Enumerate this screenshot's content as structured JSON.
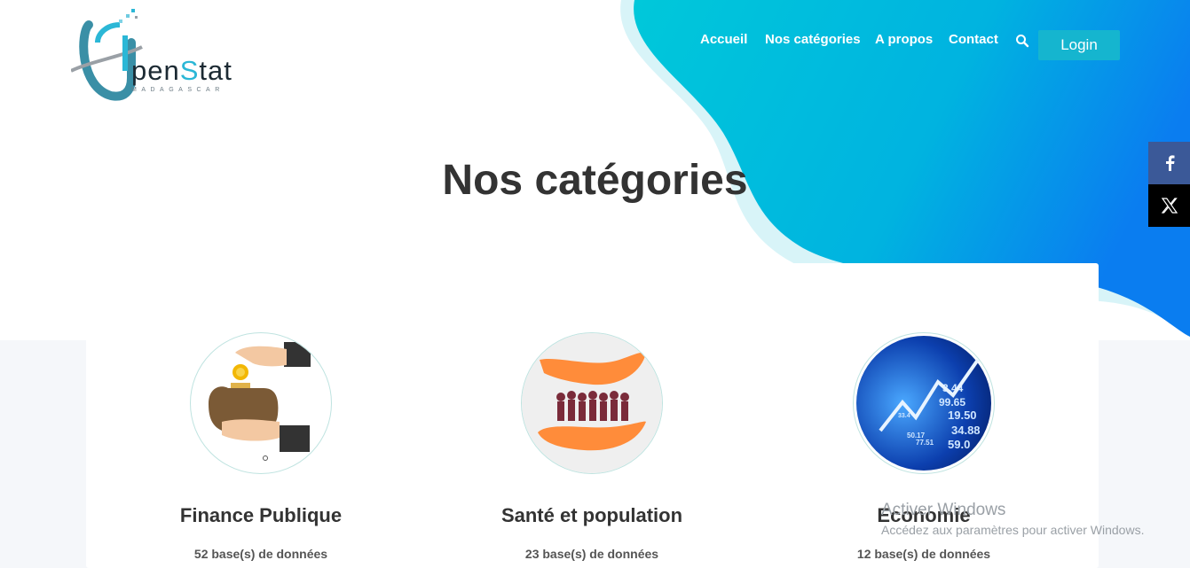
{
  "brand": {
    "logo_main_1": "pen",
    "logo_main_2": "S",
    "logo_main_3": "tat",
    "logo_sub": "MADAGASCAR"
  },
  "nav": {
    "items": [
      "Accueil",
      "Nos catégories",
      "A propos",
      "Contact"
    ],
    "login_label": "Login"
  },
  "page": {
    "title": "Nos catégories"
  },
  "social": [
    {
      "icon": "facebook-icon"
    },
    {
      "icon": "x-icon"
    }
  ],
  "categories": [
    {
      "title": "Finance Publique",
      "count": "52 base(s) de données",
      "image": "wallet-coin-illustration"
    },
    {
      "title": "Santé et population",
      "count": "23 base(s) de données",
      "image": "hands-protecting-people-illustration"
    },
    {
      "title": "Economie",
      "count": "12 base(s) de données",
      "image": "stock-numbers-illustration"
    }
  ],
  "watermark": {
    "line1": "Activer Windows",
    "line2": "Accédez aux paramètres pour activer Windows."
  },
  "colors": {
    "accent": "#15b5cf",
    "blob_start": "#00c2dc",
    "blob_end": "#0a7df0",
    "facebook": "#3b5998"
  }
}
